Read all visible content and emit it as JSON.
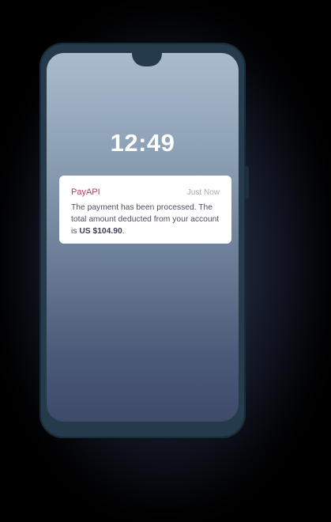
{
  "lock_screen": {
    "time": "12:49"
  },
  "notification": {
    "app_name": "PayAPI",
    "time_label": "Just Now",
    "message_prefix": "The payment has been processed. The total amount deducted from your account is ",
    "amount": "US $104.90",
    "message_suffix": "."
  },
  "colors": {
    "phone_body": "#253a4a",
    "app_name": "#b53a64",
    "screen_top": "#a9bccd",
    "screen_bottom": "#3e4a6a"
  }
}
